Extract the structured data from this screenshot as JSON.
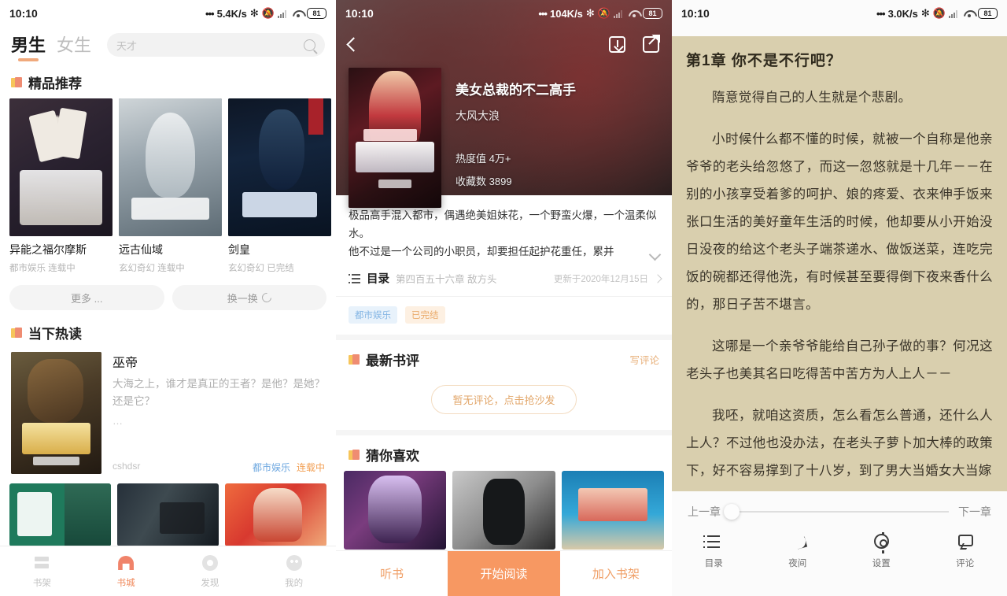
{
  "panel1": {
    "statusbar": {
      "time": "10:10",
      "speed": "5.4K/s",
      "battery": "81"
    },
    "tabs": [
      {
        "label": "男生",
        "active": true
      },
      {
        "label": "女生",
        "active": false
      }
    ],
    "search": {
      "placeholder": "天才",
      "icon": "search-icon"
    },
    "section_featured": {
      "title": "精品推荐",
      "icon": "book-badge-icon"
    },
    "featured_books": [
      {
        "title": "异能之福尔摩斯",
        "category": "都市娱乐",
        "status": "连载中",
        "cover": "cv-poker"
      },
      {
        "title": "远古仙域",
        "category": "玄幻奇幻",
        "status": "连载中",
        "cover": "cv-xian"
      },
      {
        "title": "剑皇",
        "category": "玄幻奇幻",
        "status": "已完结",
        "cover": "cv-jian"
      }
    ],
    "pills": [
      {
        "label": "更多 ...",
        "icon": ""
      },
      {
        "label": "换一换",
        "icon": "refresh-icon"
      }
    ],
    "section_hot": {
      "title": "当下热读",
      "icon": "book-badge-icon"
    },
    "hot_book": {
      "title": "巫帝",
      "desc": "大海之上，谁才是真正的王者？是他？是她？还是它？",
      "ellipsis": "…",
      "author": "cshdsr",
      "category": "都市娱乐",
      "status": "连载中",
      "cover": "cv-wudi"
    },
    "wide_covers": [
      "cv-green",
      "cv-dark",
      "cv-red"
    ],
    "tabbar": [
      {
        "label": "书架",
        "icon": "bookshelf-icon",
        "active": false
      },
      {
        "label": "书城",
        "icon": "bookstore-icon",
        "active": true
      },
      {
        "label": "发现",
        "icon": "discover-icon",
        "active": false
      },
      {
        "label": "我的",
        "icon": "profile-icon",
        "active": false
      }
    ]
  },
  "panel2": {
    "statusbar": {
      "time": "10:10",
      "speed": "104K/s",
      "battery": "81"
    },
    "nav": {
      "back": "back-icon",
      "download": "download-icon",
      "share": "share-icon"
    },
    "book": {
      "title": "美女总裁的不二高手",
      "author": "大风大浪",
      "heat_label": "热度值",
      "heat_value": "4万+",
      "fav_label": "收藏数",
      "fav_value": "3899",
      "cover": "cv-mn"
    },
    "description": {
      "line1": "极品高手混入都市，偶遇绝美姐妹花，一个野蛮火爆，一个温柔似水。",
      "line2": "他不过是一个公司的小职员，却要担任起护花重任，累并",
      "expand_icon": "chevron-down-icon"
    },
    "catalog": {
      "icon": "list-icon",
      "label": "目录",
      "latest_chapter": "第四百五十六章 敌方头…",
      "updated": "更新于2020年12月15日",
      "arrow": "chevron-right-icon"
    },
    "tags": [
      {
        "label": "都市娱乐",
        "style": "blue"
      },
      {
        "label": "已完结",
        "style": "orange"
      }
    ],
    "reviews": {
      "title": "最新书评",
      "icon": "book-badge-icon",
      "write_label": "写评论",
      "empty_label": "暂无评论，点击抢沙发"
    },
    "recommend": {
      "title": "猜你喜欢",
      "icon": "book-badge-icon",
      "covers": [
        "cv-purple",
        "cv-gray",
        "cv-blue"
      ]
    },
    "actions": [
      {
        "label": "听书",
        "primary": false
      },
      {
        "label": "开始阅读",
        "primary": true
      },
      {
        "label": "加入书架",
        "primary": false
      }
    ]
  },
  "panel3": {
    "statusbar": {
      "time": "10:10",
      "speed": "3.0K/s",
      "battery": "81"
    },
    "nav": {
      "back": "back-icon",
      "listen": "headphones-icon",
      "download": "download-icon",
      "more": "more-icon"
    },
    "chapter_title": "第1章  你不是不行吧？",
    "paragraphs": [
      "隋意觉得自己的人生就是个悲剧。",
      "小时候什么都不懂的时候，就被一个自称是他亲爷爷的老头给忽悠了，而这一忽悠就是十几年－－在别的小孩享受着爹的呵护、娘的疼爱、衣来伸手饭来张口生活的美好童年生活的时候，他却要从小开始没日没夜的给这个老头子端茶递水、做饭送菜，连吃完饭的碗都还得他洗，有时候甚至要得倒下夜来香什么的，那日子苦不堪言。",
      "这哪是一个亲爷爷能给自己孙子做的事？何况这老头子也美其名曰吃得苦中苦方为人上人－－",
      "我呸，就咱这资质，怎么看怎么普通，还什么人上人？不过他也没办法，在老头子萝卜加大棒的政策下，好不容易撑到了十八岁，到了男大当婚女大当嫁"
    ],
    "seek": {
      "prev": "上一章",
      "next": "下一章",
      "progress": 0
    },
    "toolbar": [
      {
        "label": "目录",
        "icon": "toc-icon"
      },
      {
        "label": "夜间",
        "icon": "moon-icon"
      },
      {
        "label": "设置",
        "icon": "gear-icon"
      },
      {
        "label": "评论",
        "icon": "comment-icon"
      }
    ]
  },
  "colors": {
    "accent": "#f79862",
    "reader_bg": "#d9cfae",
    "tag_blue": "#85b6e4",
    "tag_orange": "#eaab6b"
  }
}
